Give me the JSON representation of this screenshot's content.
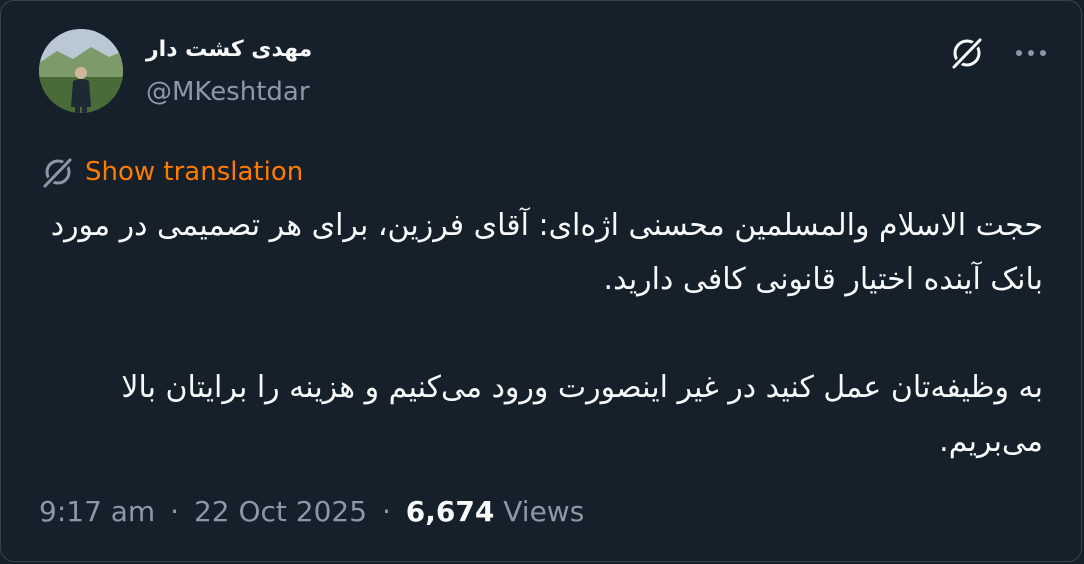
{
  "author": {
    "display_name": "مهدی کشت دار",
    "handle": "@MKeshtdar"
  },
  "actions": {
    "grok_icon": "grok-icon",
    "more_icon": "more-dots-icon"
  },
  "translation": {
    "label": "Show translation",
    "icon": "translate-icon",
    "color": "#ff7a00"
  },
  "tweet": {
    "paragraphs": [
      "حجت الاسلام والمسلمین محسنی اژه‌ای: آقای فرزین، برای هر تصمیمی در مورد بانک آینده اختیار قانونی کافی دارید.",
      "به وظیفه‌تان عمل کنید در غیر اینصورت ورود می‌کنیم و هزینه را برایتان بالا می‌بریم."
    ]
  },
  "meta": {
    "time": "9:17 am",
    "separator": "·",
    "date": "22 Oct 2025",
    "views_count": "6,674",
    "views_label": "Views"
  },
  "colors": {
    "background": "#15202b",
    "text": "#f7f9f9",
    "secondary": "#8b98a5",
    "border": "#38444d"
  }
}
